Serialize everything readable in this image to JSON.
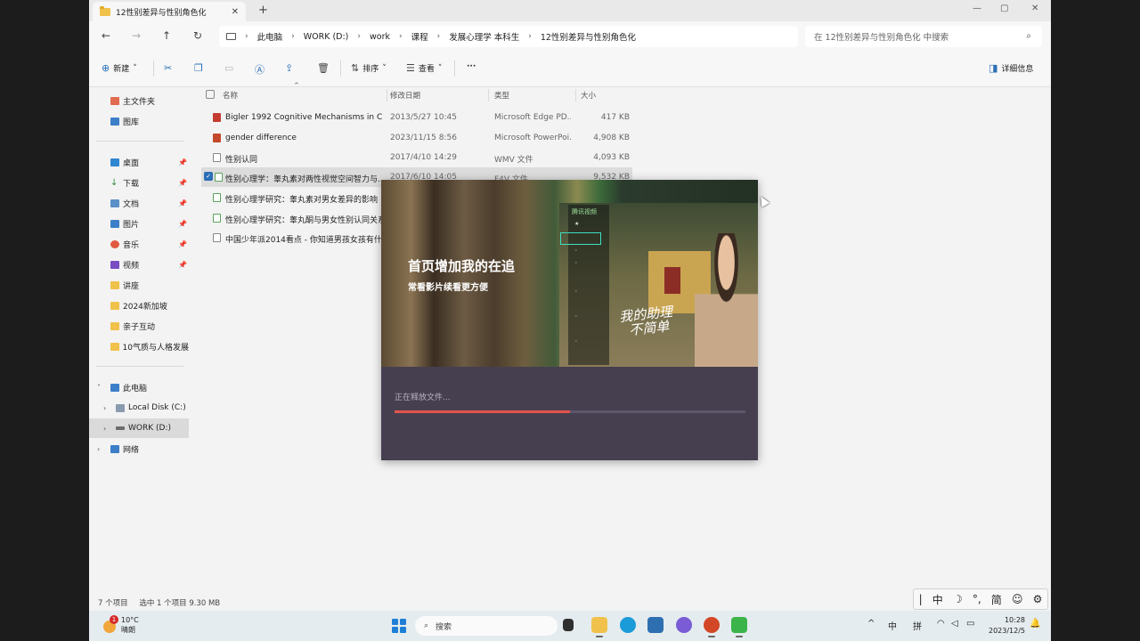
{
  "window": {
    "tab_title": "12性别差异与性别角色化",
    "new_tab": "+",
    "minimize": "—",
    "maximize": "▢",
    "close": "✕"
  },
  "nav": {
    "back": "←",
    "forward": "→",
    "up": "↑",
    "refresh": "↻"
  },
  "breadcrumb": [
    "此电脑",
    "WORK (D:)",
    "work",
    "课程",
    "发展心理学 本科生",
    "12性别差异与性别角色化"
  ],
  "search": {
    "placeholder": "在 12性别差异与性别角色化 中搜索"
  },
  "toolbar": {
    "new": "新建",
    "sort": "排序",
    "view": "查看",
    "more": "···",
    "details": "详细信息"
  },
  "sidebar": {
    "quick": [
      {
        "label": "主文件夹"
      },
      {
        "label": "图库"
      }
    ],
    "pinned": [
      {
        "label": "桌面"
      },
      {
        "label": "下载"
      },
      {
        "label": "文档"
      },
      {
        "label": "图片"
      },
      {
        "label": "音乐"
      },
      {
        "label": "视频"
      },
      {
        "label": "讲座"
      },
      {
        "label": "2024新加坡"
      },
      {
        "label": "亲子互动"
      },
      {
        "label": "10气质与人格发展"
      }
    ],
    "thispc": "此电脑",
    "drive_c": "Local Disk (C:)",
    "drive_d": "WORK (D:)",
    "network": "网络"
  },
  "columns": {
    "name": "名称",
    "modified": "修改日期",
    "type": "类型",
    "size": "大小"
  },
  "files": [
    {
      "name": "Bigler 1992 Cognitive Mechanisms in Chi...",
      "modified": "2013/5/27 10:45",
      "type": "Microsoft Edge PD...",
      "size": "417 KB",
      "color": "#c43b2f"
    },
    {
      "name": "gender difference",
      "modified": "2023/11/15 8:56",
      "type": "Microsoft PowerPoi...",
      "size": "4,908 KB",
      "color": "#c4482b"
    },
    {
      "name": "性别认同",
      "modified": "2017/4/10 14:29",
      "type": "WMV 文件",
      "size": "4,093 KB",
      "color": "#7b7b7b"
    },
    {
      "name": "性别心理学：睾丸素对两性视觉空间智力与...",
      "modified": "2017/6/10 14:05",
      "type": "F4V 文件",
      "size": "9,532 KB",
      "color": "#5aa35a"
    },
    {
      "name": "性别心理学研究：睾丸素对男女差异的影响",
      "modified": "",
      "type": "",
      "size": "",
      "color": "#5aa35a"
    },
    {
      "name": "性别心理学研究：睾丸酮与男女性别认同关系",
      "modified": "",
      "type": "",
      "size": "",
      "color": "#5aa35a"
    },
    {
      "name": "中国少年派2014看点 - 你知道男孩女孩有什...",
      "modified": "",
      "type": "",
      "size": "",
      "color": "#7b7b7b"
    }
  ],
  "status": {
    "count": "7 个项目",
    "selected": "选中 1 个项目  9.30 MB"
  },
  "popup": {
    "headline": "首页增加我的在追",
    "subline": "常看影片续看更方便",
    "app_name": "腾讯视频",
    "show_title": "我的助理\n不简单",
    "progress_label": "正在释放文件...",
    "progress": 0.5
  },
  "ime": [
    "|",
    "中",
    "☽",
    "°,",
    "简",
    "☺",
    "⚙"
  ],
  "taskbar": {
    "temp": "10°C",
    "weather": "晴朗",
    "badge": "1",
    "search": "搜索",
    "tray_ime1": "中",
    "tray_ime2": "拼",
    "time": "10:28",
    "date": "2023/12/5"
  }
}
